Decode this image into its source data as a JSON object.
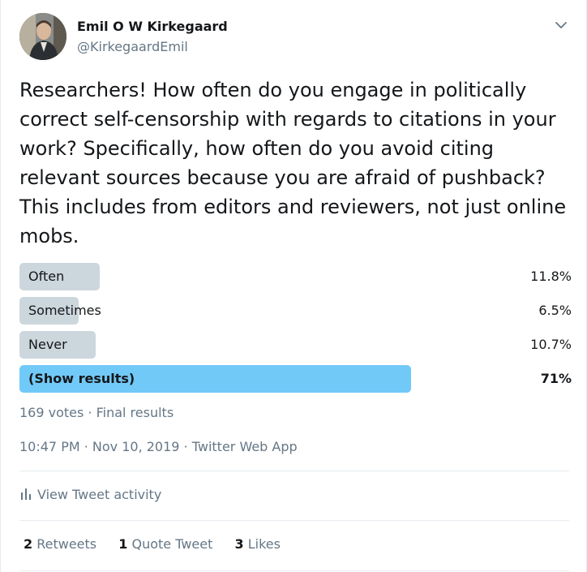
{
  "author": {
    "name": "Emil O W Kirkegaard",
    "handle": "@KirkegaardEmil"
  },
  "tweet_text": "Researchers! How often do you engage in politically correct self-censorship with regards to citations in your work? Specifically, how often do you avoid citing relevant sources because you are afraid of pushback? This includes from editors and reviewers, not just online mobs.",
  "poll": {
    "options": [
      {
        "label": "Often",
        "percent_text": "11.8%",
        "value": 11.8
      },
      {
        "label": "Sometimes",
        "percent_text": "6.5%",
        "value": 6.5
      },
      {
        "label": "Never",
        "percent_text": "10.7%",
        "value": 10.7
      },
      {
        "label": "(Show results)",
        "percent_text": "71%",
        "value": 71
      }
    ],
    "summary": "169 votes · Final results"
  },
  "meta": {
    "time": "10:47 PM · Nov 10, 2019",
    "separator": " · ",
    "source": "Twitter Web App"
  },
  "activity_label": "View Tweet activity",
  "stats": {
    "retweets_count": "2",
    "retweets_label": "Retweets",
    "quotes_count": "1",
    "quotes_label": "Quote Tweet",
    "likes_count": "3",
    "likes_label": "Likes"
  },
  "colors": {
    "bar": "#ccd6dd",
    "winning_bar": "#71c9f8",
    "secondary_text": "#657786"
  },
  "icons": [
    "chevron-down-icon",
    "bar-chart-icon"
  ]
}
